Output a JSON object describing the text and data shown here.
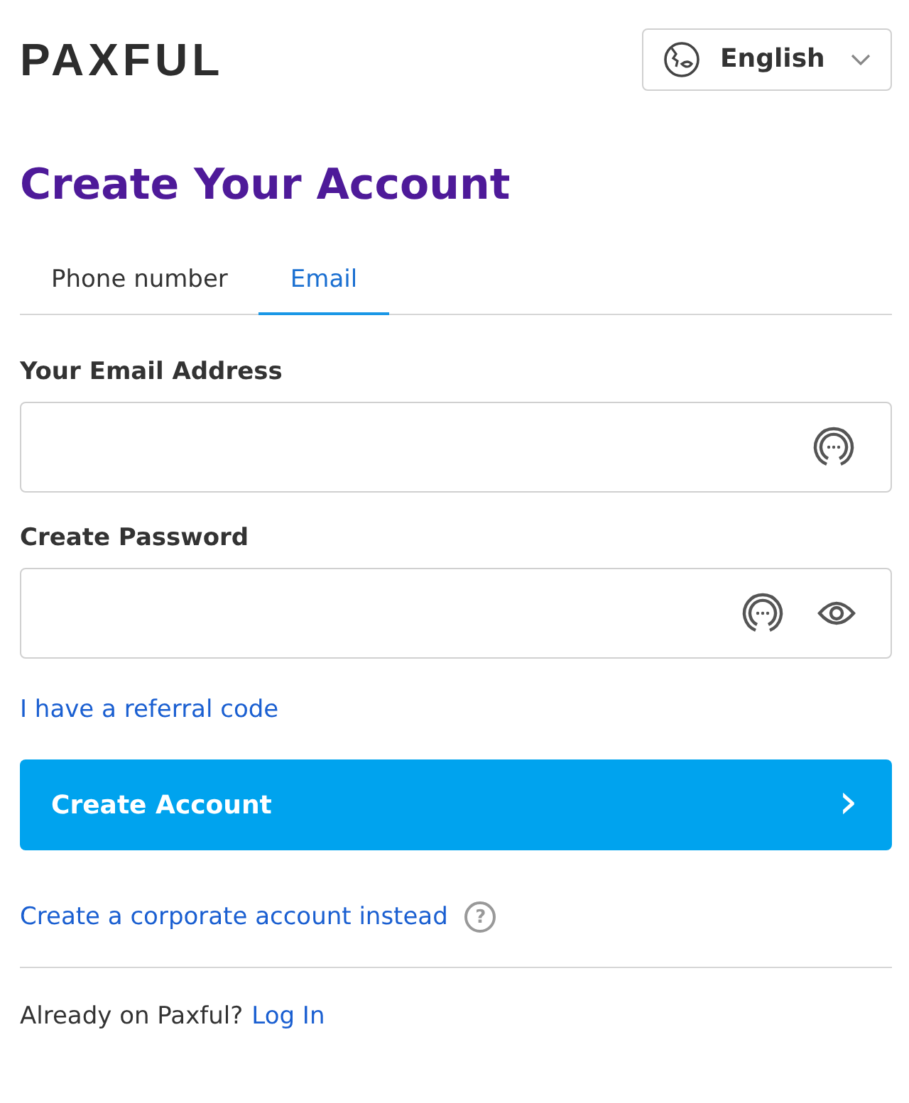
{
  "logo": "PAXFUL",
  "language": {
    "label": "English"
  },
  "title": "Create Your Account",
  "tabs": [
    {
      "label": "Phone number",
      "selected": false
    },
    {
      "label": "Email",
      "selected": true
    }
  ],
  "fields": [
    {
      "label": "Your Email Address",
      "kind": "email"
    },
    {
      "label": "Create Password",
      "kind": "password"
    }
  ],
  "referral_link": "I have a referral code",
  "submit": {
    "label": "Create Account",
    "chevron": "›"
  },
  "corporate_link": "Create a corporate account instead",
  "help_icon": "?",
  "login": {
    "text": "Already on Paxful?",
    "link": "Log In"
  }
}
